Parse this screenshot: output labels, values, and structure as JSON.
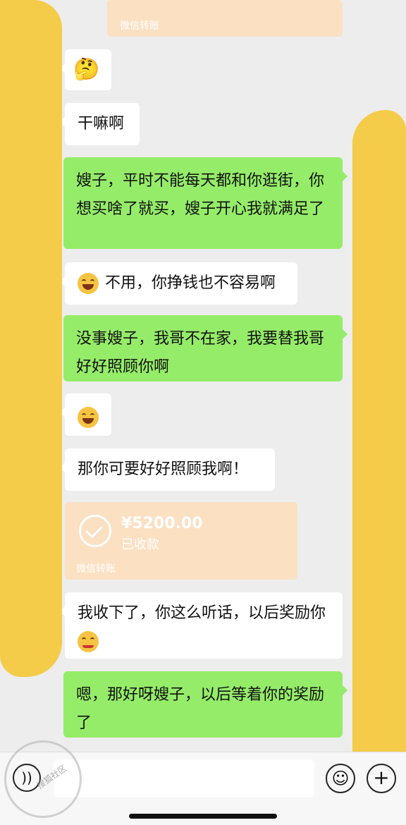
{
  "messages": {
    "m1_emoji": "🤔",
    "m2": "干嘛啊",
    "m3": "嫂子，平时不能每天都和你逛街，你想买啥了就买，嫂子开心我就满足了",
    "m4": "不用，你挣钱也不容易啊",
    "m5": "没事嫂子，我哥不在家，我要替我哥好好照顾你啊",
    "m6_emoji": "😁",
    "m7": "那你可要好好照顾我啊！",
    "m9": "我收下了，你这么听话，以后奖励你",
    "m10": "嗯，那好呀嫂子，以后等着你的奖励了"
  },
  "top_transfer": {
    "footer": "微信转账"
  },
  "transfer": {
    "amount": "¥5200.00",
    "status": "已收款",
    "footer": "微信转账"
  },
  "bottom_bar": {
    "voice_icon": "voice-icon",
    "emoji_icon": "emoji-icon",
    "plus_icon": "plus-icon"
  },
  "watermark": {
    "text": "搜狐社区"
  },
  "colors": {
    "background": "#ededed",
    "sent_bubble": "#95ec69",
    "received_bubble": "#ffffff",
    "transfer_card": "#fbe0c2",
    "cover_yellow": "#f4cc4a"
  }
}
